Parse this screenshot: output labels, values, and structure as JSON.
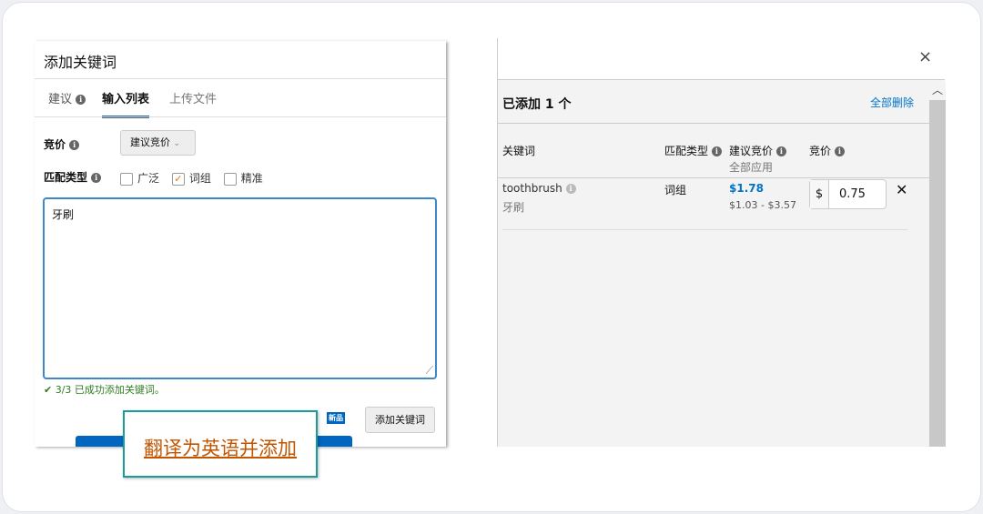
{
  "left_panel": {
    "title": "添加关键词",
    "tabs": [
      {
        "label": "建议"
      },
      {
        "label": "输入列表",
        "active": true
      },
      {
        "label": "上传文件"
      }
    ],
    "bid_label": "竞价",
    "bid_select": "建议竞价",
    "match_label": "匹配类型",
    "match_options": [
      {
        "label": "广泛",
        "checked": false
      },
      {
        "label": "词组",
        "checked": true
      },
      {
        "label": "精准",
        "checked": false
      }
    ],
    "textarea_value": "牙刷",
    "status": "3/3 已成功添加关键词。",
    "new_badge": "新品",
    "add_button": "添加关键词",
    "translate_link": "翻译为英语并添加"
  },
  "right_panel": {
    "close": "×",
    "added_title": "已添加 1 个",
    "delete_all": "全部删除",
    "columns": {
      "keyword": "关键词",
      "match": "匹配类型",
      "suggested": "建议竞价",
      "apply_all": "全部应用",
      "bid": "竞价"
    },
    "rows": [
      {
        "keyword": "toothbrush",
        "translation": "牙刷",
        "match": "词组",
        "suggested": "$1.78",
        "range": "$1.03 - $3.57",
        "currency": "$",
        "bid": "0.75"
      }
    ]
  },
  "colors": {
    "accent": "#0066c0",
    "link": "#0073c7",
    "orange": "#c45500",
    "teal": "#1a9a9a",
    "success": "#2f7d1f"
  }
}
